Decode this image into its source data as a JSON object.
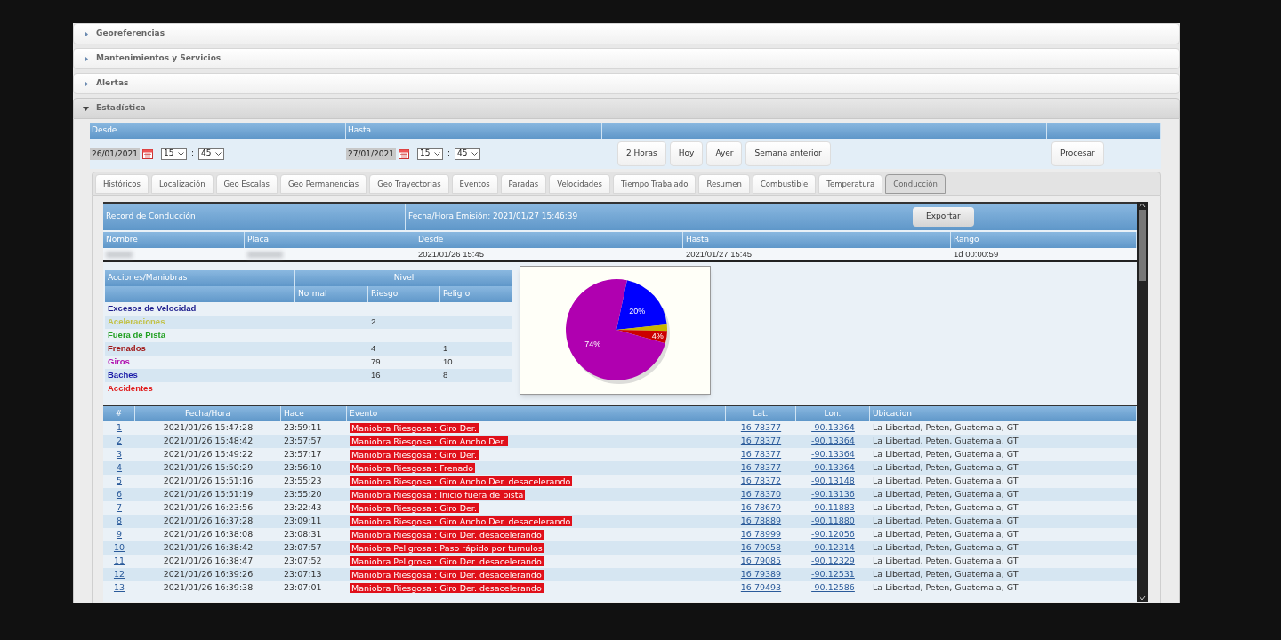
{
  "accordion": [
    {
      "label": "Georeferencias",
      "expanded": false
    },
    {
      "label": "Mantenimientos y Servicios",
      "expanded": false
    },
    {
      "label": "Alertas",
      "expanded": false
    },
    {
      "label": "Estadística",
      "expanded": true
    }
  ],
  "range": {
    "headers": [
      "Desde",
      "Hasta"
    ],
    "from": {
      "date": "26/01/2021",
      "hour": "15",
      "minute": "45"
    },
    "to": {
      "date": "27/01/2021",
      "hour": "15",
      "minute": "45"
    },
    "separator": ":",
    "quick_buttons": [
      "2 Horas",
      "Hoy",
      "Ayer",
      "Semana anterior"
    ],
    "process_button": "Procesar"
  },
  "tabs": [
    {
      "label": "Históricos",
      "selected": false
    },
    {
      "label": "Localización",
      "selected": false
    },
    {
      "label": "Geo Escalas",
      "selected": false
    },
    {
      "label": "Geo Permanencias",
      "selected": false
    },
    {
      "label": "Geo Trayectorias",
      "selected": false
    },
    {
      "label": "Eventos",
      "selected": false
    },
    {
      "label": "Paradas",
      "selected": false
    },
    {
      "label": "Velocidades",
      "selected": false
    },
    {
      "label": "Tiempo Trabajado",
      "selected": false
    },
    {
      "label": "Resumen",
      "selected": false
    },
    {
      "label": "Combustible",
      "selected": false
    },
    {
      "label": "Temperatura",
      "selected": false
    },
    {
      "label": "Conducción",
      "selected": true
    }
  ],
  "report": {
    "title": "Record de Conducción",
    "issued": "Fecha/Hora Emisión: 2021/01/27 15:46:39",
    "export_button": "Exportar",
    "columns": [
      "Nombre",
      "Placa",
      "Desde",
      "Hasta",
      "Rango"
    ],
    "row": {
      "desde": "2021/01/26 15:45",
      "hasta": "2021/01/27 15:45",
      "rango": "1d 00:00:59"
    }
  },
  "maneuvers": {
    "header": "Acciones/Maniobras",
    "level_header": "Nivel",
    "levels": [
      "Normal",
      "Riesgo",
      "Peligro"
    ],
    "rows": [
      {
        "name": "Excesos de Velocidad",
        "color": "#1c1c8c"
      },
      {
        "name": "Aceleraciones",
        "color": "#c2c24a",
        "riesgo": "2"
      },
      {
        "name": "Fuera de Pista",
        "color": "#22a022"
      },
      {
        "name": "Frenados",
        "color": "#a01818",
        "riesgo": "4",
        "peligro": "1"
      },
      {
        "name": "Giros",
        "color": "#b010b0",
        "riesgo": "79",
        "peligro": "10"
      },
      {
        "name": "Baches",
        "color": "#1c1ca8",
        "riesgo": "16",
        "peligro": "8"
      },
      {
        "name": "Accidentes",
        "color": "#e01818"
      }
    ]
  },
  "pie": {
    "chart_data": {
      "type": "pie",
      "values": [
        20,
        2,
        4,
        74
      ],
      "value_labels": [
        "20%",
        null,
        "4%",
        "74%"
      ],
      "colors": [
        "#0000ff",
        "#c8b400",
        "#cc0000",
        "#b000b0"
      ]
    }
  },
  "events": {
    "columns": [
      "#",
      "Fecha/Hora",
      "Hace",
      "Evento",
      "Lat.",
      "Lon.",
      "Ubicacion"
    ],
    "rows": [
      {
        "n": "1",
        "time": "2021/01/26 15:47:28",
        "ago": "23:59:11",
        "event": "Maniobra Riesgosa : Giro Der.",
        "lat": "16.78377",
        "lon": "-90.13364",
        "place": "La Libertad, Peten, Guatemala, GT"
      },
      {
        "n": "2",
        "time": "2021/01/26 15:48:42",
        "ago": "23:57:57",
        "event": "Maniobra Riesgosa : Giro Ancho Der.",
        "lat": "16.78377",
        "lon": "-90.13364",
        "place": "La Libertad, Peten, Guatemala, GT"
      },
      {
        "n": "3",
        "time": "2021/01/26 15:49:22",
        "ago": "23:57:17",
        "event": "Maniobra Riesgosa : Giro Der.",
        "lat": "16.78377",
        "lon": "-90.13364",
        "place": "La Libertad, Peten, Guatemala, GT"
      },
      {
        "n": "4",
        "time": "2021/01/26 15:50:29",
        "ago": "23:56:10",
        "event": "Maniobra Riesgosa : Frenado",
        "lat": "16.78377",
        "lon": "-90.13364",
        "place": "La Libertad, Peten, Guatemala, GT"
      },
      {
        "n": "5",
        "time": "2021/01/26 15:51:16",
        "ago": "23:55:23",
        "event": "Maniobra Riesgosa : Giro Ancho Der. desacelerando",
        "lat": "16.78372",
        "lon": "-90.13148",
        "place": "La Libertad, Peten, Guatemala, GT"
      },
      {
        "n": "6",
        "time": "2021/01/26 15:51:19",
        "ago": "23:55:20",
        "event": "Maniobra Riesgosa : Inicio fuera de pista",
        "lat": "16.78370",
        "lon": "-90.13136",
        "place": "La Libertad, Peten, Guatemala, GT"
      },
      {
        "n": "7",
        "time": "2021/01/26 16:23:56",
        "ago": "23:22:43",
        "event": "Maniobra Riesgosa : Giro Der.",
        "lat": "16.78679",
        "lon": "-90.11883",
        "place": "La Libertad, Peten, Guatemala, GT"
      },
      {
        "n": "8",
        "time": "2021/01/26 16:37:28",
        "ago": "23:09:11",
        "event": "Maniobra Riesgosa : Giro Ancho Der. desacelerando",
        "lat": "16.78889",
        "lon": "-90.11880",
        "place": "La Libertad, Peten, Guatemala, GT"
      },
      {
        "n": "9",
        "time": "2021/01/26 16:38:08",
        "ago": "23:08:31",
        "event": "Maniobra Riesgosa : Giro Der. desacelerando",
        "lat": "16.78999",
        "lon": "-90.12056",
        "place": "La Libertad, Peten, Guatemala, GT"
      },
      {
        "n": "10",
        "time": "2021/01/26 16:38:42",
        "ago": "23:07:57",
        "event": "Maniobra Peligrosa : Paso rápido por tumulos",
        "lat": "16.79058",
        "lon": "-90.12314",
        "place": "La Libertad, Peten, Guatemala, GT"
      },
      {
        "n": "11",
        "time": "2021/01/26 16:38:47",
        "ago": "23:07:52",
        "event": "Maniobra Peligrosa : Giro Der. desacelerando",
        "lat": "16.79085",
        "lon": "-90.12329",
        "place": "La Libertad, Peten, Guatemala, GT"
      },
      {
        "n": "12",
        "time": "2021/01/26 16:39:26",
        "ago": "23:07:13",
        "event": "Maniobra Riesgosa : Giro Der. desacelerando",
        "lat": "16.79389",
        "lon": "-90.12531",
        "place": "La Libertad, Peten, Guatemala, GT"
      },
      {
        "n": "13",
        "time": "2021/01/26 16:39:38",
        "ago": "23:07:01",
        "event": "Maniobra Riesgosa : Giro Der. desacelerando",
        "lat": "16.79493",
        "lon": "-90.12586",
        "place": "La Libertad, Peten, Guatemala, GT"
      }
    ]
  }
}
